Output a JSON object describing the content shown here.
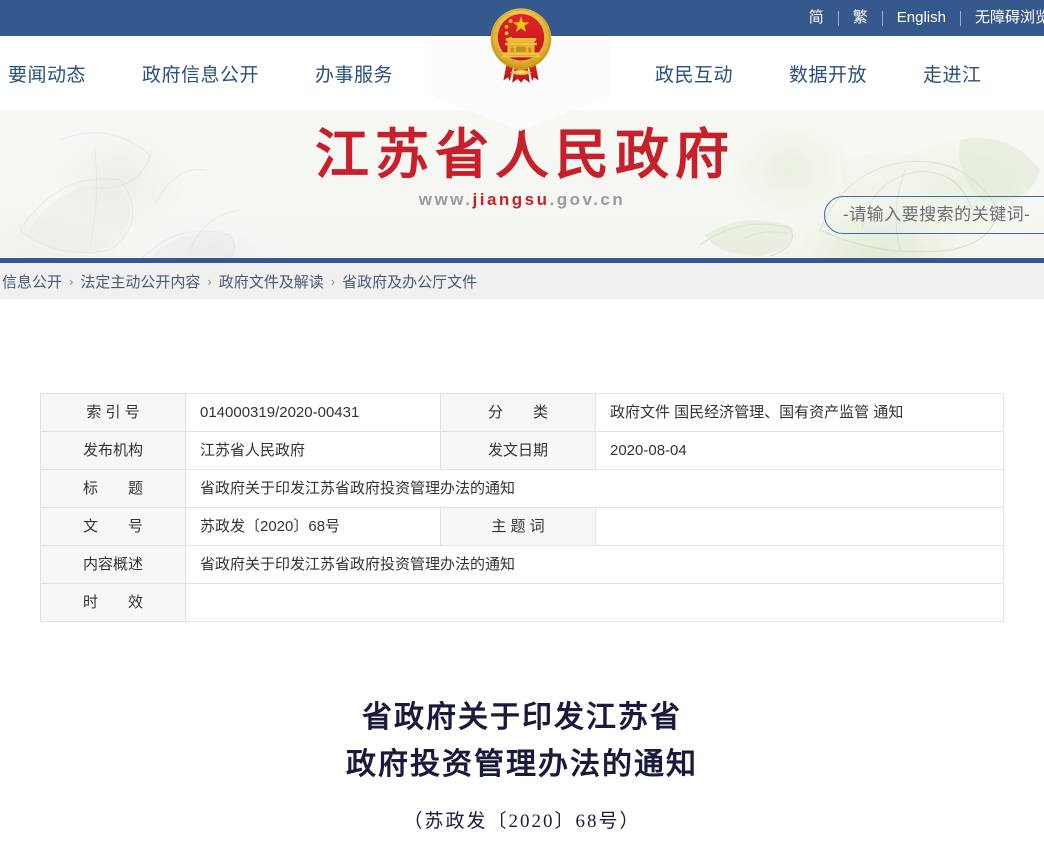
{
  "topbar": {
    "languages": [
      {
        "label": "简",
        "name": "lang-simplified"
      },
      {
        "label": "繁",
        "name": "lang-traditional"
      },
      {
        "label": "English",
        "name": "lang-english"
      },
      {
        "label": "无障碍浏览",
        "name": "accessibility"
      }
    ]
  },
  "nav": {
    "left": [
      "要闻动态",
      "政府信息公开",
      "办事服务"
    ],
    "right": [
      "政民互动",
      "数据开放",
      "走进江"
    ]
  },
  "banner": {
    "emblem_alt": "national-emblem",
    "title": "江苏省人民政府",
    "url_prefix": "www.",
    "url_highlight": "jiangsu",
    "url_suffix": ".gov.cn",
    "colors": {
      "title_red": "#c8202a",
      "header_blue": "#36598d",
      "breadcrumb_bg": "#f0f0f0"
    }
  },
  "search": {
    "placeholder": "-请输入要搜索的关键词-",
    "value": ""
  },
  "breadcrumb": {
    "items": [
      "信息公开",
      "法定主动公开内容",
      "政府文件及解读",
      "省政府及办公厅文件"
    ],
    "separator": "›"
  },
  "meta": {
    "rows": [
      {
        "label1": "索 引 号",
        "value1": "014000319/2020-00431",
        "label2": "分　　类",
        "value2": "政府文件 国民经济管理、国有资产监管 通知"
      },
      {
        "label1": "发布机构",
        "value1": "江苏省人民政府",
        "label2": "发文日期",
        "value2": "2020-08-04"
      },
      {
        "label1": "标　　题",
        "value1": "省政府关于印发江苏省政府投资管理办法的通知",
        "full": true
      },
      {
        "label1": "文　　号",
        "value1": "苏政发〔2020〕68号",
        "label2": "主 题 词",
        "value2": ""
      },
      {
        "label1": "内容概述",
        "value1": "省政府关于印发江苏省政府投资管理办法的通知",
        "full": true
      },
      {
        "label1": "时　　效",
        "value1": "",
        "full": true
      }
    ]
  },
  "document": {
    "title_line1": "省政府关于印发江苏省",
    "title_line2": "政府投资管理办法的通知",
    "number": "（苏政发〔2020〕68号）"
  }
}
